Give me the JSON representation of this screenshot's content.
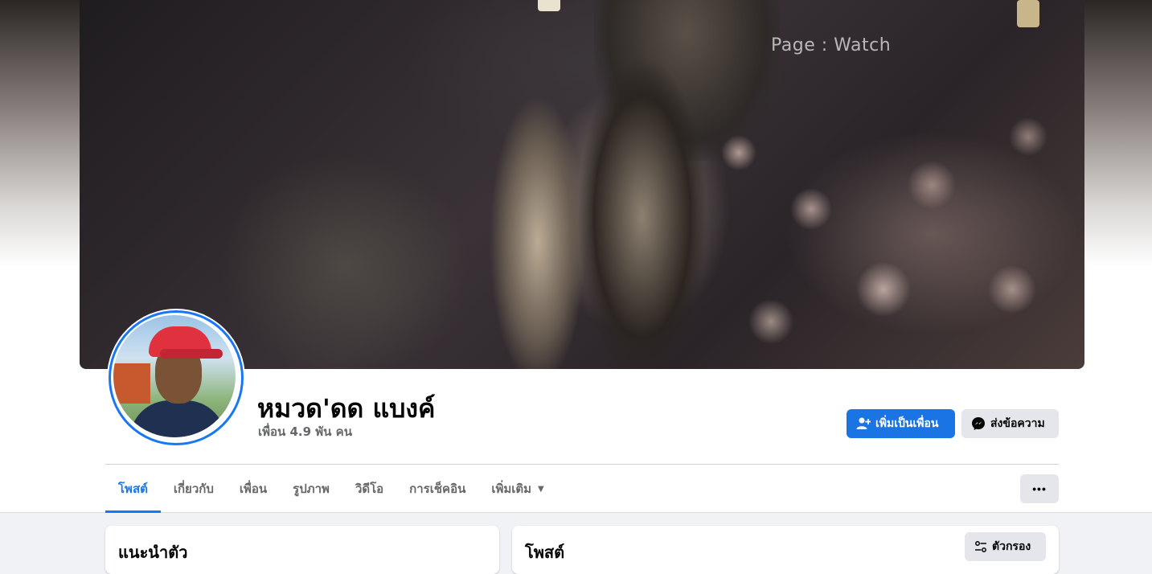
{
  "cover": {
    "watermark": "Page : Watch"
  },
  "profile": {
    "name": "หมวด'ดด แบงค์",
    "friends": "เพื่อน 4.9 พัน คน"
  },
  "actions": {
    "add_friend": "เพิ่มเป็นเพื่อน",
    "message": "ส่งข้อความ",
    "more": "•••"
  },
  "tabs": [
    {
      "label": "โพสต์",
      "active": true
    },
    {
      "label": "เกี่ยวกับ",
      "active": false
    },
    {
      "label": "เพื่อน",
      "active": false
    },
    {
      "label": "รูปภาพ",
      "active": false
    },
    {
      "label": "วิดีโอ",
      "active": false
    },
    {
      "label": "การเช็คอิน",
      "active": false
    },
    {
      "label": "เพิ่มเติม",
      "active": false
    }
  ],
  "intro": {
    "title": "แนะนำตัว"
  },
  "posts": {
    "title": "โพสต์",
    "filter": "ตัวกรอง"
  },
  "colors": {
    "accent": "#1877f2",
    "button_primary": "#1b74e4",
    "button_secondary": "#e4e6eb",
    "background": "#f0f2f5"
  },
  "icons": {
    "add_friend": "add-friend-icon",
    "message": "messenger-icon",
    "more_caret": "caret-down-icon",
    "filter": "filter-sliders-icon"
  }
}
